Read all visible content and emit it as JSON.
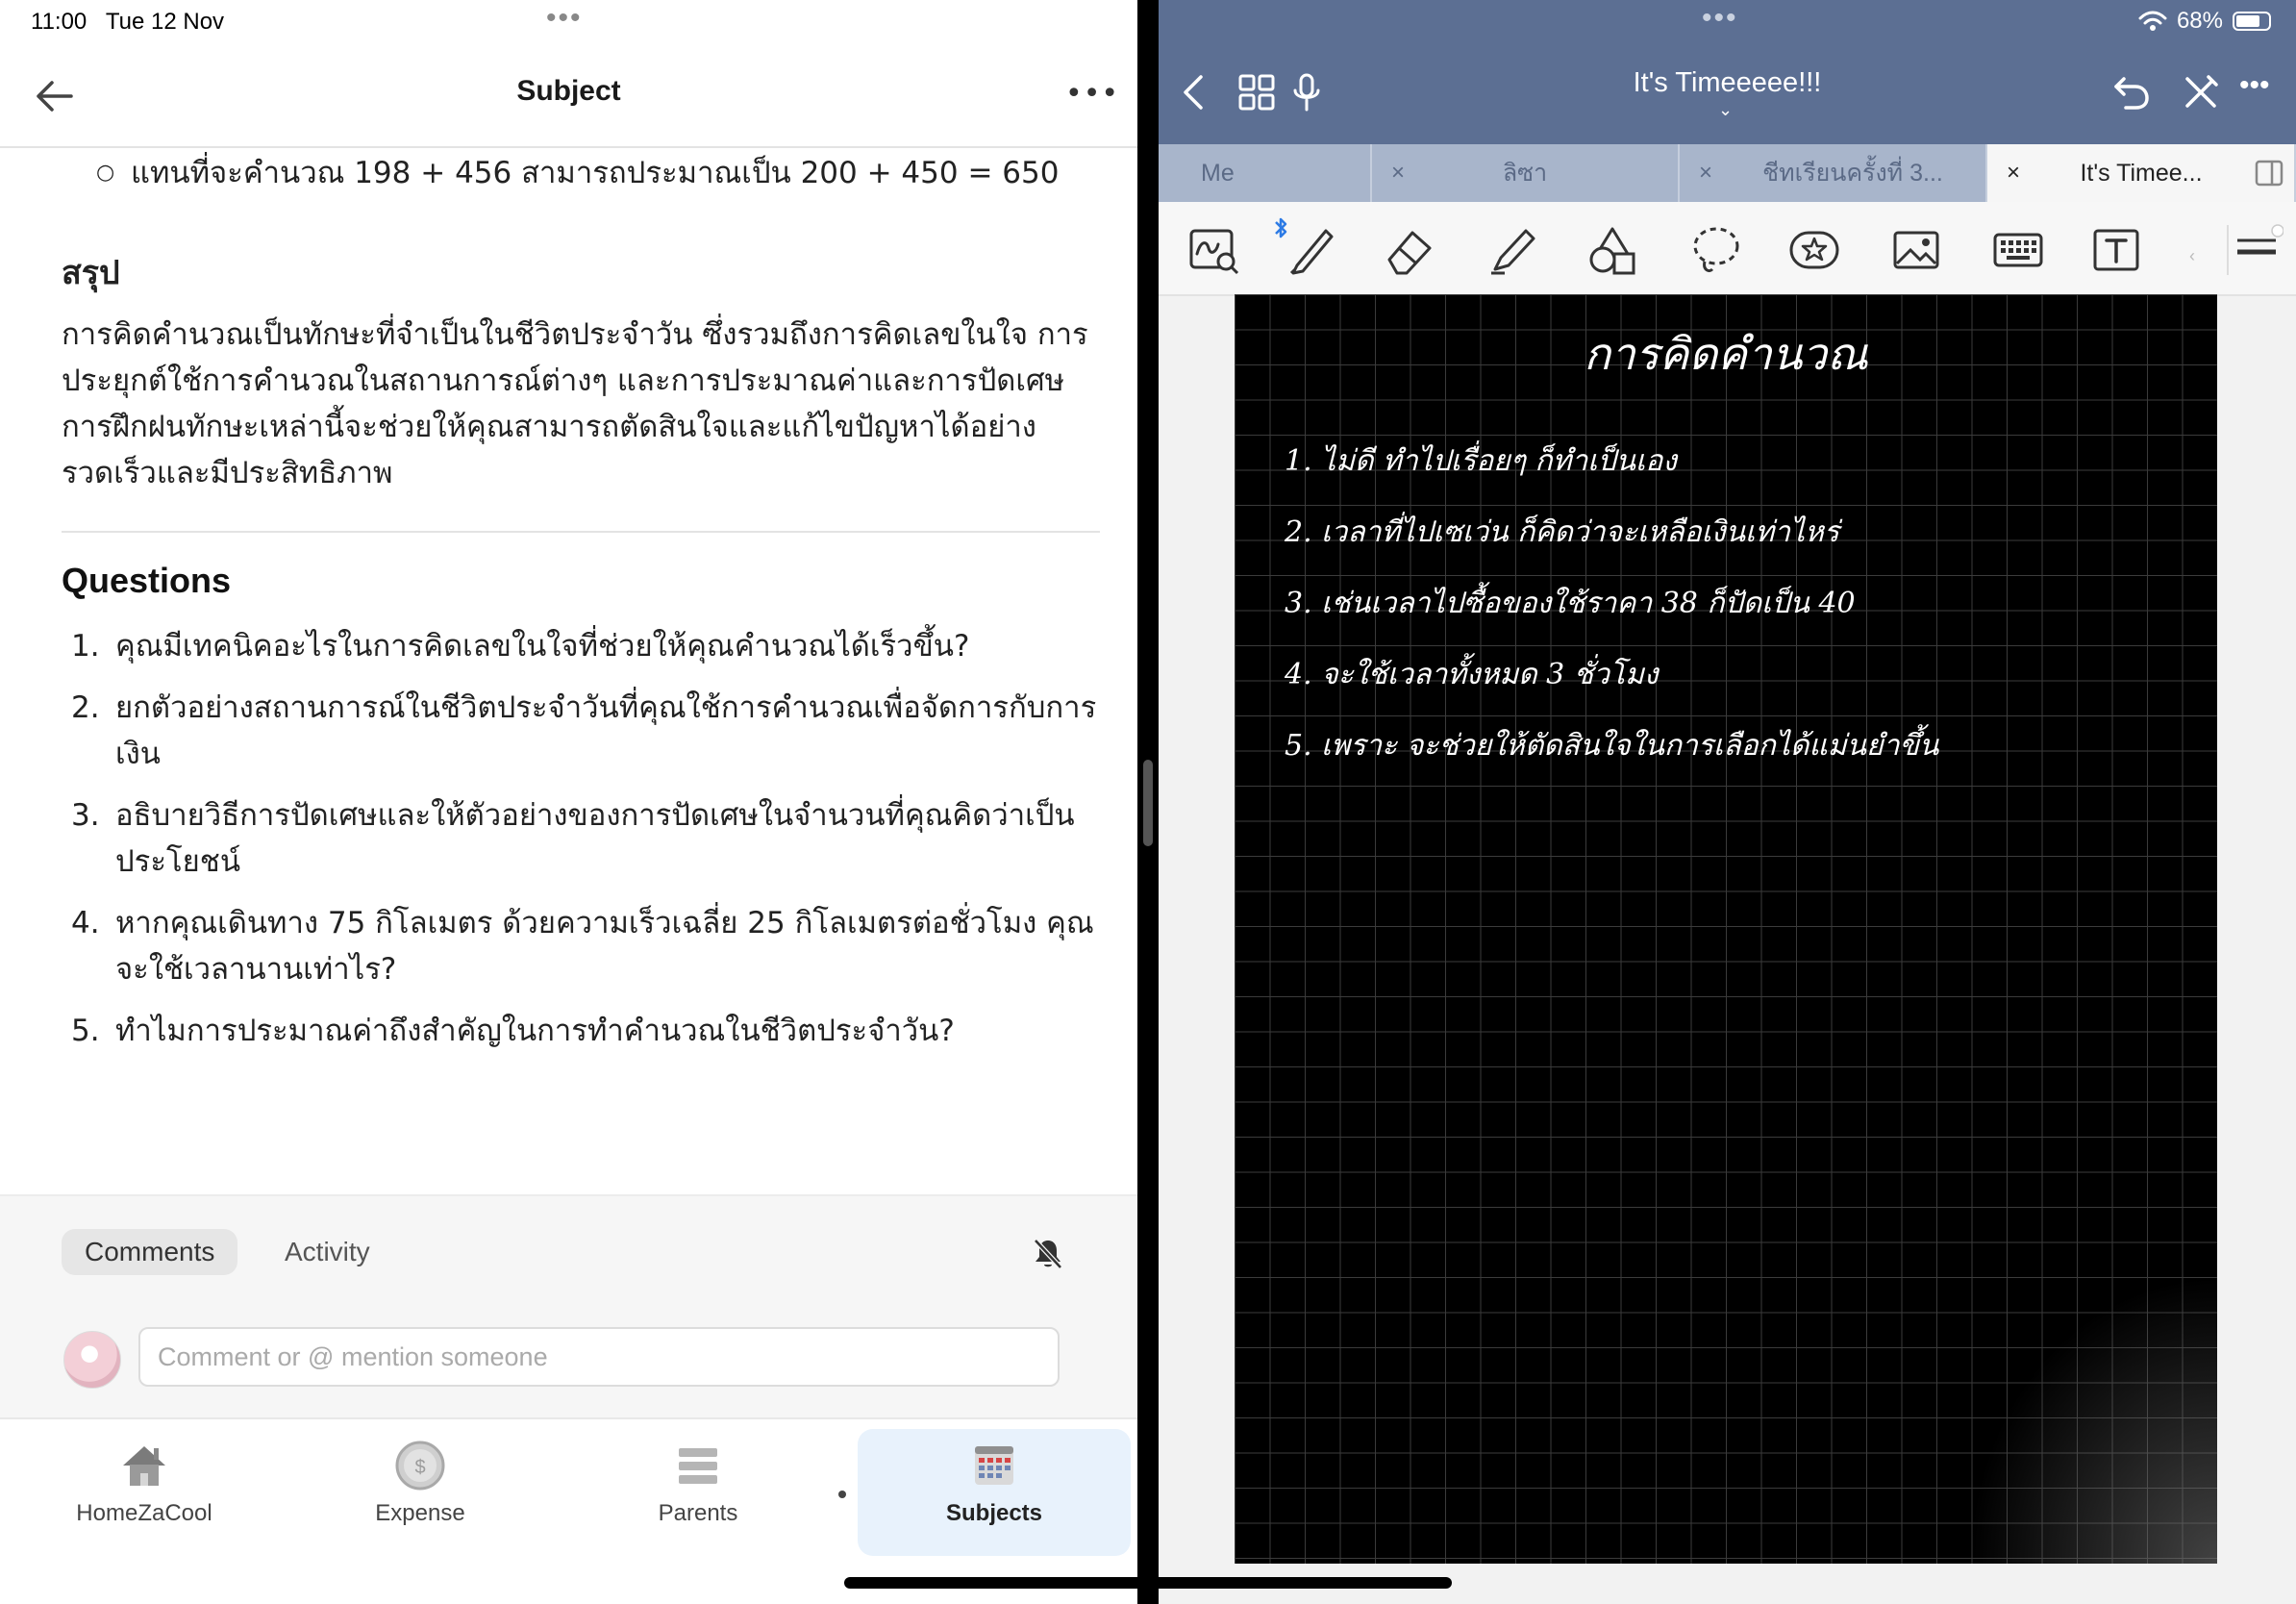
{
  "status_left": {
    "time": "11:00",
    "date": "Tue 12 Nov"
  },
  "status_right": {
    "battery": "68%"
  },
  "left": {
    "title": "Subject",
    "bullet": "แทนที่จะคำนวณ 198 + 456 สามารถประมาณเป็น 200 + 450 = 650",
    "summary_heading": "สรุป",
    "summary_text": "การคิดคำนวณเป็นทักษะที่จำเป็นในชีวิตประจำวัน ซึ่งรวมถึงการคิดเลขในใจ การประยุกต์ใช้การคำนวณในสถานการณ์ต่างๆ และการประมาณค่าและการปัดเศษ การฝึกฝนทักษะเหล่านี้จะช่วยให้คุณสามารถตัดสินใจและแก้ไขปัญหาได้อย่างรวดเร็วและมีประสิทธิภาพ",
    "questions_heading": "Questions",
    "questions": [
      {
        "num": "1.",
        "text": "คุณมีเทคนิคอะไรในการคิดเลขในใจที่ช่วยให้คุณคำนวณได้เร็วขึ้น?"
      },
      {
        "num": "2.",
        "text": "ยกตัวอย่างสถานการณ์ในชีวิตประจำวันที่คุณใช้การคำนวณเพื่อจัดการกับการเงิน"
      },
      {
        "num": "3.",
        "text": "อธิบายวิธีการปัดเศษและให้ตัวอย่างของการปัดเศษในจำนวนที่คุณคิดว่าเป็นประโยชน์"
      },
      {
        "num": "4.",
        "text": "หากคุณเดินทาง 75 กิโลเมตร ด้วยความเร็วเฉลี่ย 25 กิโลเมตรต่อชั่วโมง คุณจะใช้เวลานานเท่าไร?"
      },
      {
        "num": "5.",
        "text": "ทำไมการประมาณค่าถึงสำคัญในการทำคำนวณในชีวิตประจำวัน?"
      }
    ],
    "comments_tab": "Comments",
    "activity_tab": "Activity",
    "comment_placeholder": "Comment or @ mention someone",
    "tabbar": [
      {
        "label": "HomeZaCool",
        "icon": "home-icon"
      },
      {
        "label": "Expense",
        "icon": "coin-icon"
      },
      {
        "label": "Parents",
        "icon": "list-icon"
      },
      {
        "label": "Subjects",
        "icon": "calendar-icon"
      }
    ]
  },
  "right": {
    "notebook_title": "It's Timeeeee!!!",
    "tabs": [
      {
        "label": "Me"
      },
      {
        "label": "ลิซา"
      },
      {
        "label": "ชีทเรียนครั้งที่ 3..."
      },
      {
        "label": "It's Timee..."
      }
    ],
    "note_title": "การคิดคำนวณ",
    "note_lines": [
      "1. ไม่ดี ทำไปเรื่อยๆ ก็ทำเป็นเอง",
      "2. เวลาที่ไปเซเว่น ก็คิดว่าจะเหลือเงินเท่าไหร่",
      "3. เช่นเวลาไปซื้อของใช้ราคา 38 ก็ปัดเป็น 40",
      "4. จะใช้เวลาทั้งหมด 3 ชั่วโมง",
      "5. เพราะ จะช่วยให้ตัดสินใจในการเลือกได้แม่นยำขึ้น"
    ]
  }
}
